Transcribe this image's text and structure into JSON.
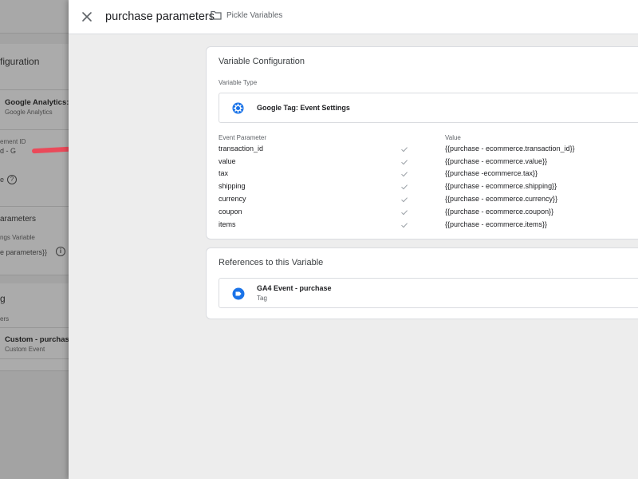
{
  "background": {
    "card1": {
      "heading": "figuration",
      "tag_type_name": "Google Analytics: G",
      "tag_type_sub": "Google Analytics",
      "measurement_label": "ement ID",
      "measurement_value": "d - G",
      "option_label": "e",
      "params_heading": "arameters",
      "settings_label": "ngs Variable",
      "settings_value": "e parameters}}"
    },
    "card2": {
      "heading": "g",
      "label": "ers",
      "trigger_name": "Custom - purchase",
      "trigger_type": "Custom Event"
    }
  },
  "header": {
    "title": "purchase parameters",
    "folder_label": "Pickle Variables"
  },
  "config": {
    "title": "Variable Configuration",
    "type_label": "Variable Type",
    "type_name": "Google Tag: Event Settings",
    "col_param": "Event Parameter",
    "col_value": "Value",
    "rows": [
      {
        "param": "transaction_id",
        "value": "{{purchase - ecommerce.transaction_id}}"
      },
      {
        "param": "value",
        "value": "{{purchase - ecommerce.value}}"
      },
      {
        "param": "tax",
        "value": "{{purchase -ecommerce.tax}}"
      },
      {
        "param": "shipping",
        "value": "{{purchase - ecommerce.shipping}}"
      },
      {
        "param": "currency",
        "value": "{{purchase - ecommerce.currency}}"
      },
      {
        "param": "coupon",
        "value": "{{purchase - ecommerce.coupon}}"
      },
      {
        "param": "items",
        "value": "{{purchase - ecommerce.items}}"
      }
    ]
  },
  "references": {
    "title": "References to this Variable",
    "item_name": "GA4 Event - purchase",
    "item_type": "Tag"
  },
  "colors": {
    "accent": "#1a73e8",
    "check": "#9aa0a6",
    "overlay": "#a3a3a3",
    "redaction": "#ea4a5a"
  }
}
